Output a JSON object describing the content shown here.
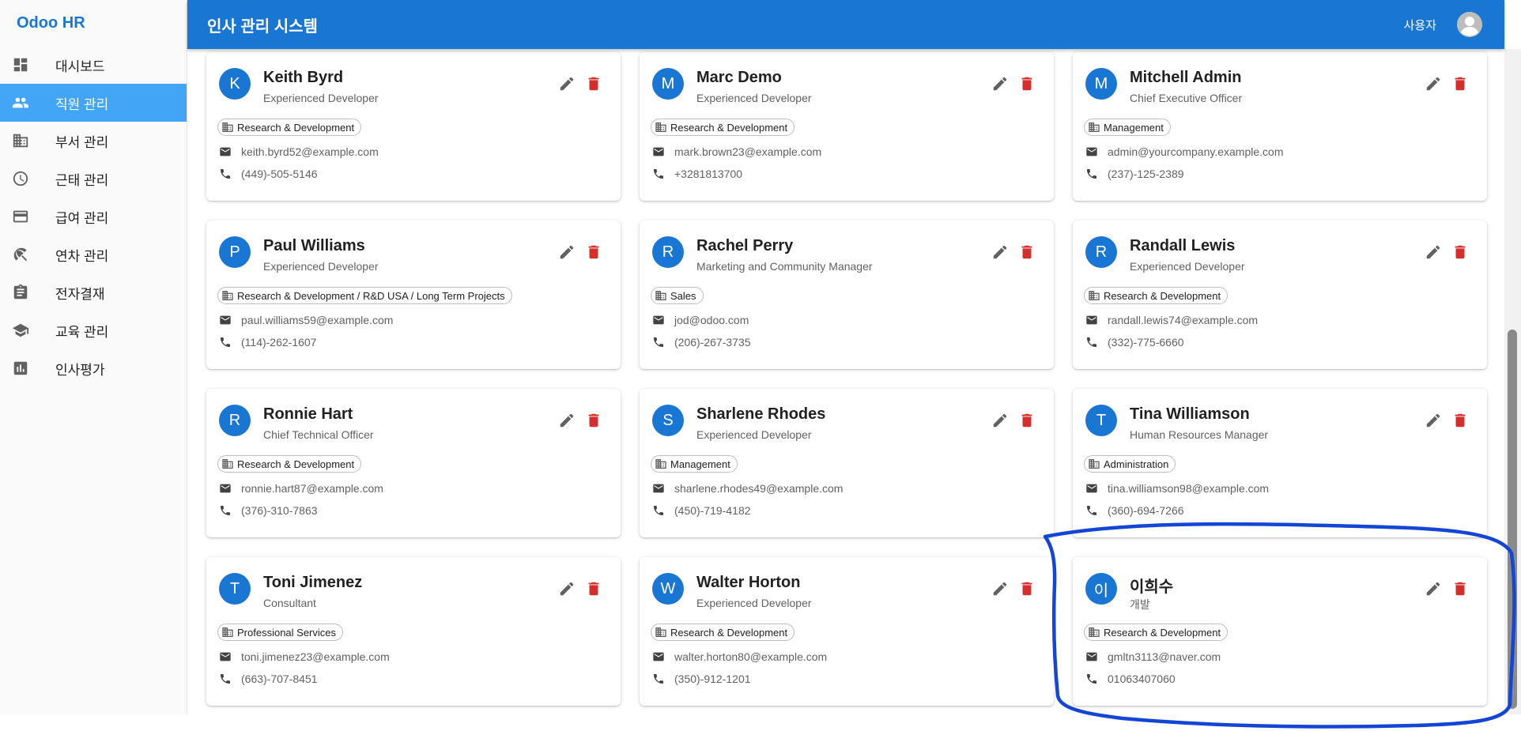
{
  "app": {
    "brand": "Odoo HR",
    "header_title": "인사 관리 시스템",
    "user_label": "사용자"
  },
  "colors": {
    "primary": "#1976d2",
    "active_nav": "#42a5f5",
    "delete": "#d32f2f",
    "annotation": "#1446d6"
  },
  "nav": [
    {
      "label": "대시보드",
      "icon": "dashboard-icon"
    },
    {
      "label": "직원 관리",
      "icon": "people-icon",
      "active": true
    },
    {
      "label": "부서 관리",
      "icon": "domain-icon"
    },
    {
      "label": "근태 관리",
      "icon": "clock-icon"
    },
    {
      "label": "급여 관리",
      "icon": "credit-card-icon"
    },
    {
      "label": "연차 관리",
      "icon": "beach-umbrella-icon"
    },
    {
      "label": "전자결재",
      "icon": "clipboard-icon"
    },
    {
      "label": "교육 관리",
      "icon": "school-icon"
    },
    {
      "label": "인사평가",
      "icon": "chart-icon"
    }
  ],
  "employees": [
    {
      "initial": "K",
      "name": "Keith Byrd",
      "title": "Experienced Developer",
      "department": "Research & Development",
      "email": "keith.byrd52@example.com",
      "phone": "(449)-505-5146"
    },
    {
      "initial": "M",
      "name": "Marc Demo",
      "title": "Experienced Developer",
      "department": "Research & Development",
      "email": "mark.brown23@example.com",
      "phone": "+3281813700"
    },
    {
      "initial": "M",
      "name": "Mitchell Admin",
      "title": "Chief Executive Officer",
      "department": "Management",
      "email": "admin@yourcompany.example.com",
      "phone": "(237)-125-2389"
    },
    {
      "initial": "P",
      "name": "Paul Williams",
      "title": "Experienced Developer",
      "department": "Research & Development / R&D USA / Long Term Projects",
      "email": "paul.williams59@example.com",
      "phone": "(114)-262-1607"
    },
    {
      "initial": "R",
      "name": "Rachel Perry",
      "title": "Marketing and Community Manager",
      "department": "Sales",
      "email": "jod@odoo.com",
      "phone": "(206)-267-3735"
    },
    {
      "initial": "R",
      "name": "Randall Lewis",
      "title": "Experienced Developer",
      "department": "Research & Development",
      "email": "randall.lewis74@example.com",
      "phone": "(332)-775-6660"
    },
    {
      "initial": "R",
      "name": "Ronnie Hart",
      "title": "Chief Technical Officer",
      "department": "Research & Development",
      "email": "ronnie.hart87@example.com",
      "phone": "(376)-310-7863"
    },
    {
      "initial": "S",
      "name": "Sharlene Rhodes",
      "title": "Experienced Developer",
      "department": "Management",
      "email": "sharlene.rhodes49@example.com",
      "phone": "(450)-719-4182"
    },
    {
      "initial": "T",
      "name": "Tina Williamson",
      "title": "Human Resources Manager",
      "department": "Administration",
      "email": "tina.williamson98@example.com",
      "phone": "(360)-694-7266"
    },
    {
      "initial": "T",
      "name": "Toni Jimenez",
      "title": "Consultant",
      "department": "Professional Services",
      "email": "toni.jimenez23@example.com",
      "phone": "(663)-707-8451"
    },
    {
      "initial": "W",
      "name": "Walter Horton",
      "title": "Experienced Developer",
      "department": "Research & Development",
      "email": "walter.horton80@example.com",
      "phone": "(350)-912-1201"
    },
    {
      "initial": "이",
      "name": "이희수",
      "title": "개발",
      "department": "Research & Development",
      "email": "gmltn3113@naver.com",
      "phone": "01063407060"
    }
  ]
}
